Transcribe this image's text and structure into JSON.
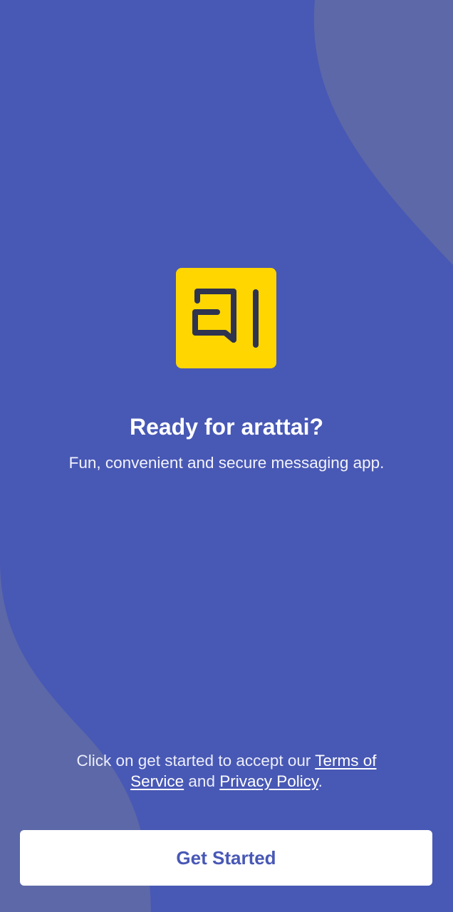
{
  "colors": {
    "background": "#4858b5",
    "background_wave": "#5c68a8",
    "logo_bg": "#ffd600",
    "logo_glyph": "#2e3350",
    "button_bg": "#ffffff",
    "button_text": "#4858b5"
  },
  "welcome": {
    "title": "Ready for arattai?",
    "subtitle": "Fun, convenient and secure messaging app."
  },
  "terms": {
    "prefix": "Click on get started to accept our ",
    "terms_link": "Terms of Service",
    "conjunction": " and ",
    "privacy_link": "Privacy Policy",
    "suffix": "."
  },
  "actions": {
    "get_started": "Get Started"
  },
  "icons": {
    "logo": "arattai-logo-icon"
  }
}
